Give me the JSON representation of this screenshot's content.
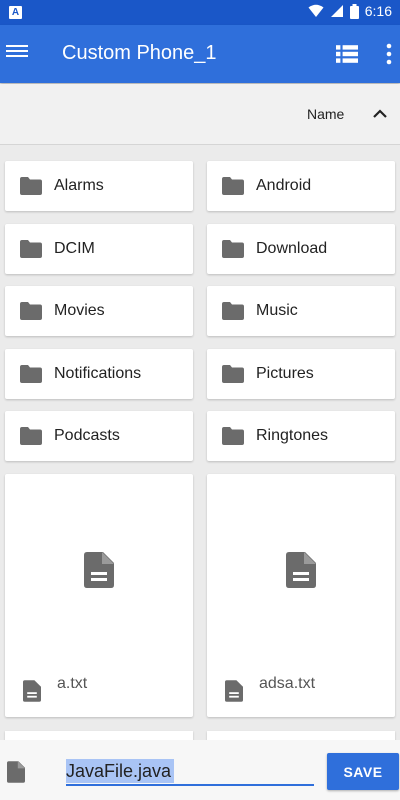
{
  "status_bar": {
    "app_icon": "A",
    "time": "6:16",
    "icons": [
      "wifi-icon",
      "signal-icon",
      "battery-icon"
    ]
  },
  "app_bar": {
    "title": "Custom Phone_1",
    "icons": [
      "menu-icon",
      "list-view-icon",
      "more-vert-icon"
    ]
  },
  "sort_bar": {
    "label": "Name",
    "direction_icon": "chevron-up-icon"
  },
  "folders": [
    {
      "label": "Alarms"
    },
    {
      "label": "Android"
    },
    {
      "label": "DCIM"
    },
    {
      "label": "Download"
    },
    {
      "label": "Movies"
    },
    {
      "label": "Music"
    },
    {
      "label": "Notifications"
    },
    {
      "label": "Pictures"
    },
    {
      "label": "Podcasts"
    },
    {
      "label": "Ringtones"
    }
  ],
  "files": [
    {
      "name": "a.txt"
    },
    {
      "name": "adsa.txt"
    }
  ],
  "save_bar": {
    "filename": "JavaFile.java",
    "save_label": "SAVE"
  },
  "colors": {
    "status_bar": "#1a57c8",
    "app_bar": "#2f6fdb",
    "icon_gray": "#6b6b6b",
    "selection": "#a9c4f5"
  }
}
